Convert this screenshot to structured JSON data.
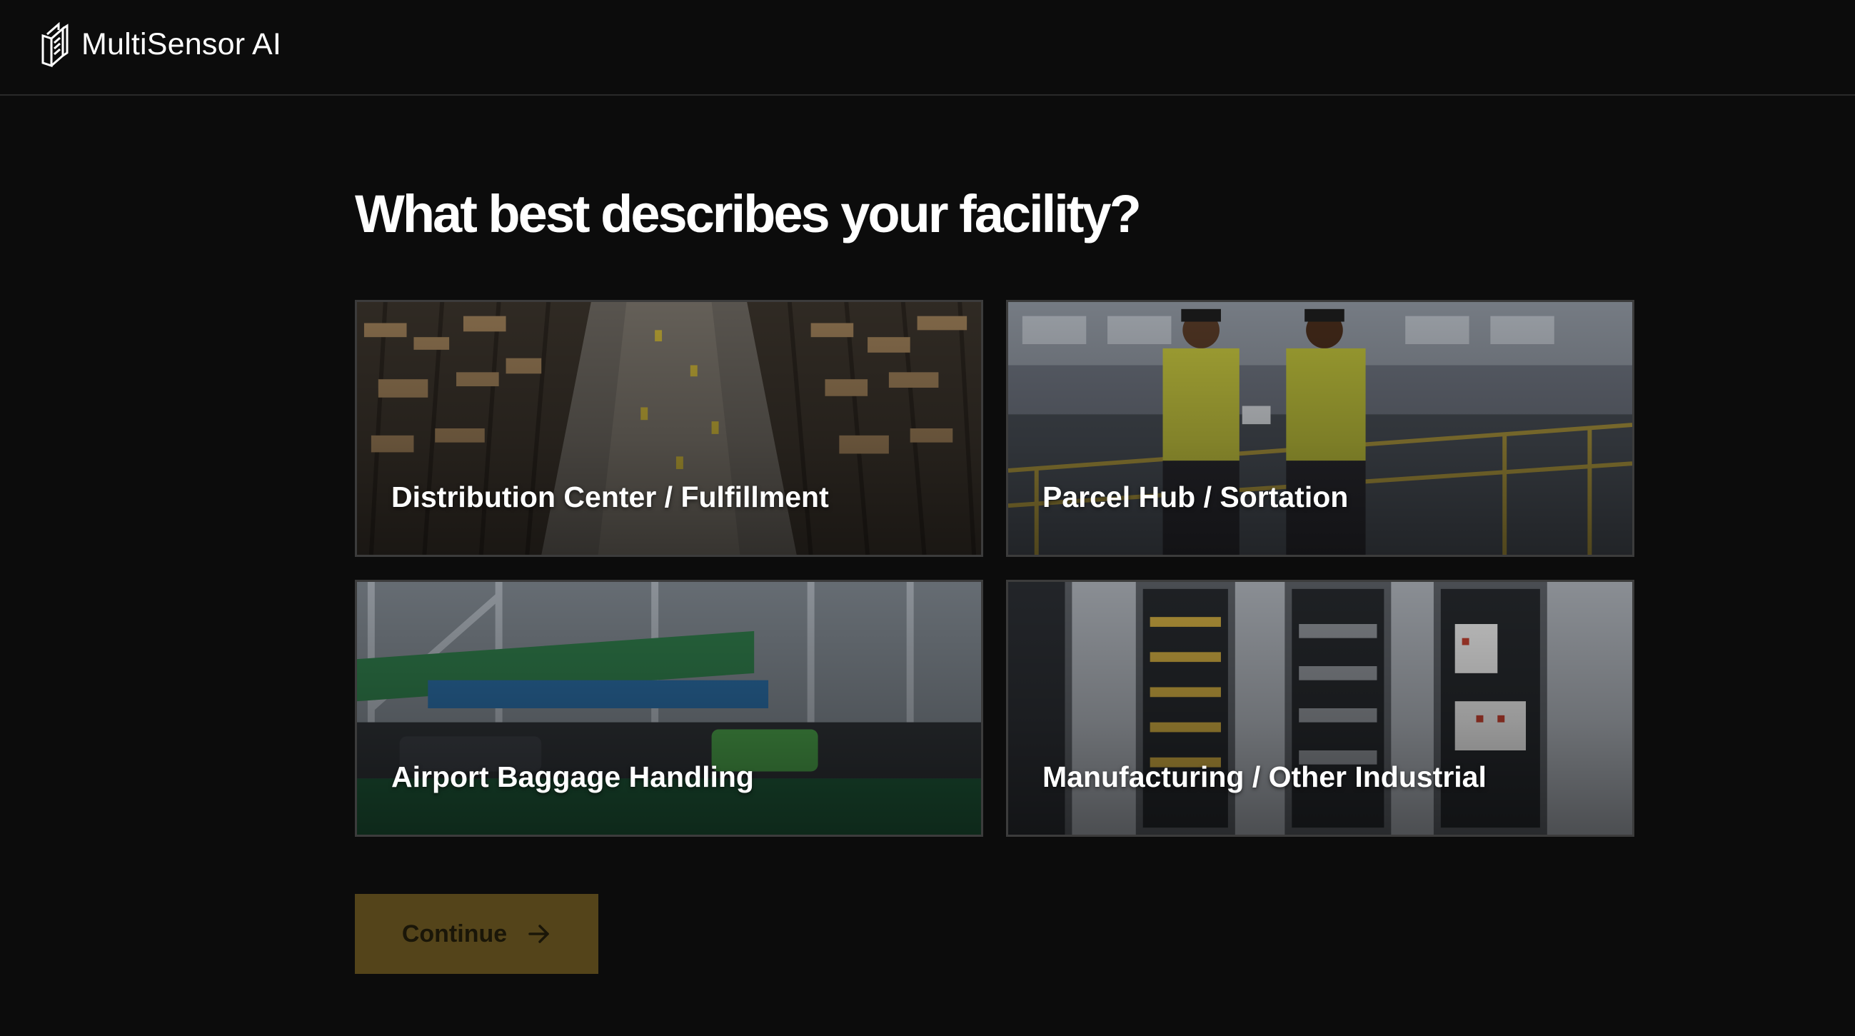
{
  "brand": {
    "name": "MultiSensor AI",
    "logo_icon": "multisensor-logo-icon"
  },
  "main": {
    "title": "What best describes your facility?",
    "options": [
      {
        "label": "Distribution Center / Fulfillment",
        "image": "warehouse-aisle-photo"
      },
      {
        "label": "Parcel Hub / Sortation",
        "image": "workers-on-mezzanine-photo"
      },
      {
        "label": "Airport Baggage Handling",
        "image": "baggage-conveyor-photo"
      },
      {
        "label": "Manufacturing / Other Industrial",
        "image": "electrical-cabinet-photo"
      }
    ],
    "continue_label": "Continue",
    "continue_icon": "arrow-right-icon"
  },
  "colors": {
    "background": "#0c0c0c",
    "card_border": "#3c3c3c",
    "continue_bg": "#54441a",
    "continue_text": "#1a1608"
  }
}
